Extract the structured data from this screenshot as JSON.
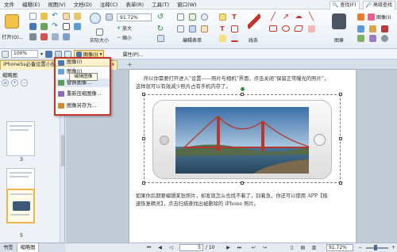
{
  "menu": [
    "文件",
    "编辑(E)",
    "视图(V)",
    "文档(D)",
    "注释(C)",
    "表单(R)",
    "工具(T)",
    "窗口(W)"
  ],
  "menu_right": {
    "search": "查找(F)",
    "adv_search": "高级查找"
  },
  "ribbon": {
    "open": "打开(O)...",
    "zoom_value": "91.72%",
    "actual_size": "实际大小",
    "zoom_in": "放大",
    "zoom_out": "缩小",
    "edit_form": "编辑表单",
    "line": "线条",
    "shape": "图章",
    "image_btn": "图像(I)"
  },
  "row2": {
    "zoom": "100%",
    "image_menu": "图像(I)",
    "attr": "属性(P)..."
  },
  "tabs": {
    "doc_title": "iPhone5s必备设置小技巧..."
  },
  "left_panel": {
    "title": "缩略图",
    "tabs": [
      "书签",
      "缩略图"
    ],
    "page_numbers": [
      "3",
      "4",
      "5"
    ]
  },
  "dropdown": {
    "header": "图像(I)",
    "items": [
      "图像(I)",
      "替换图像...",
      "重新压缩图像...",
      "图像另存为..."
    ],
    "tooltip": "编辑图像"
  },
  "page": {
    "para1_line1": "所以你需要打开进入“设置——照片与相机”界面，点击关闭“保留正常曝光的照片”，",
    "para1_line2": "这样就可以有效减少照片占有手机内存了。",
    "para2_line1": "如果你后期要编辑某张照片，却发现怎么也找不着了，别着急，你还可以使用 APP【极",
    "para2_line2": "速恢复精灵】，点击扫描查找出被删除的 iPhone 照片。"
  },
  "status": {
    "page_current": "5",
    "page_total": "/ 10",
    "zoom": "91.72%"
  },
  "colors": {
    "accent_red": "#c2362b",
    "highlight": "#f0b548",
    "ribbon_blue": "#2b6cb0"
  }
}
